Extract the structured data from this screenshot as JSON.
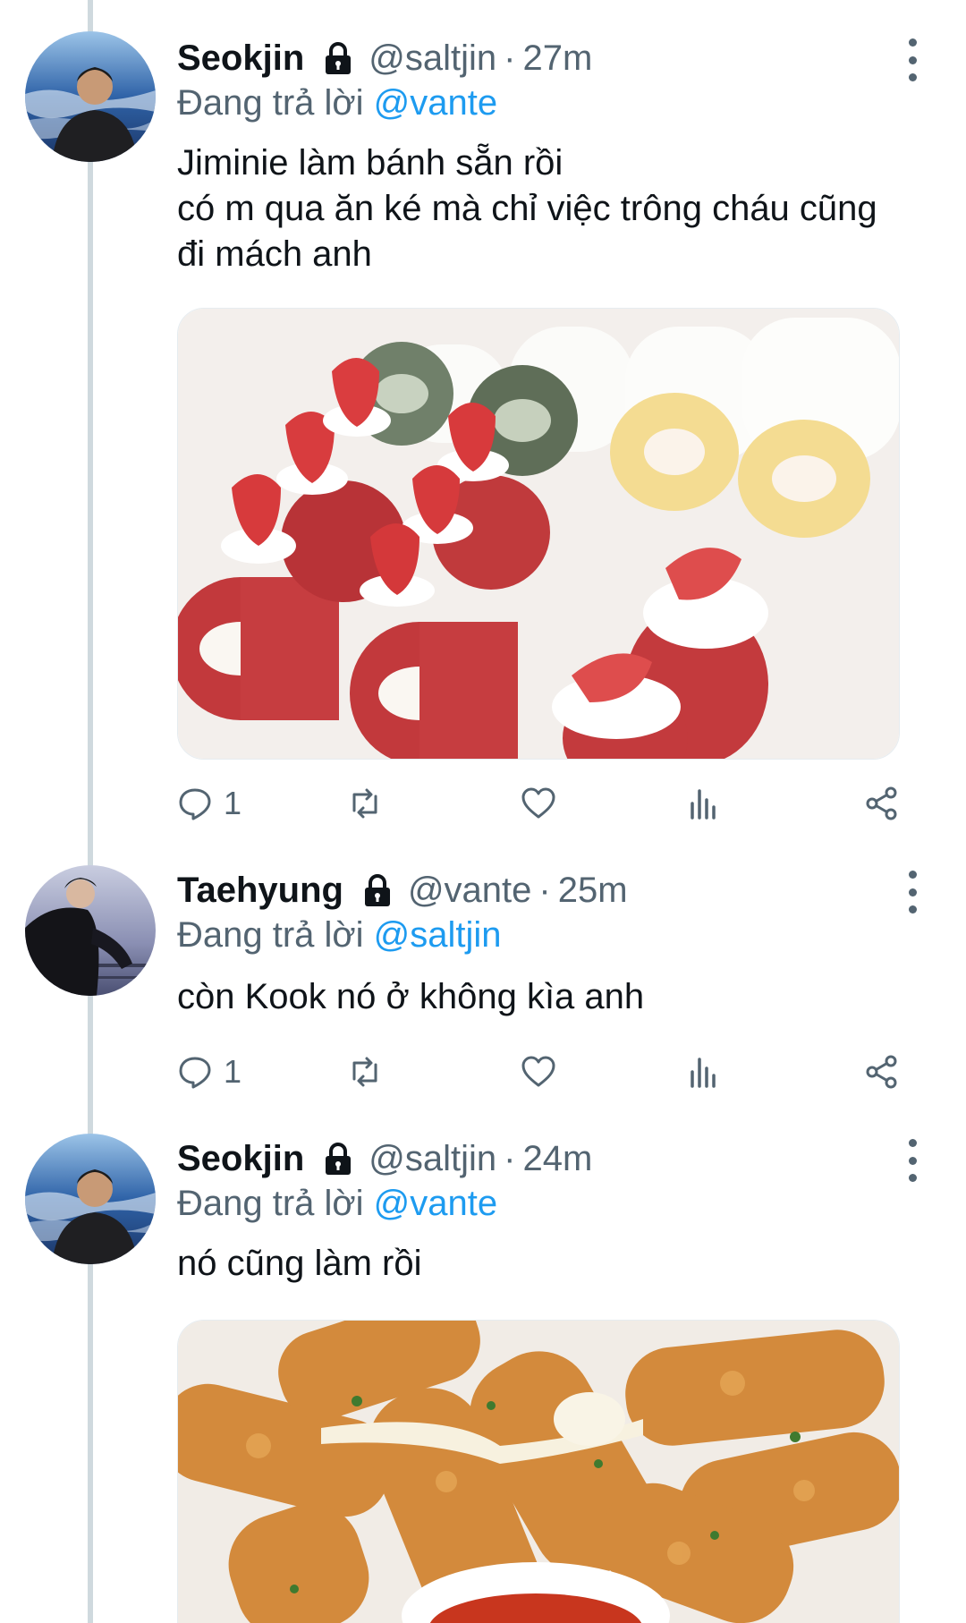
{
  "reply_prefix": "Đang trả lời",
  "tweets": [
    {
      "name": "Seokjin",
      "handle": "@saltjin",
      "separator": "·",
      "time": "27m",
      "reply_to": "@vante",
      "text_lines": [
        "Jiminie làm bánh sẵn rồi",
        "có m qua ăn ké mà chỉ việc trông cháu cũng",
        "đi mách anh"
      ],
      "media_description": "strawberry-roll-cakes-photo",
      "reply_count": "1"
    },
    {
      "name": "Taehyung",
      "handle": "@vante",
      "separator": "·",
      "time": "25m",
      "reply_to": "@saltjin",
      "text_lines": [
        "còn Kook nó ở không kìa anh"
      ],
      "reply_count": "1"
    },
    {
      "name": "Seokjin",
      "handle": "@saltjin",
      "separator": "·",
      "time": "24m",
      "reply_to": "@vante",
      "text_lines": [
        "nó cũng làm rồi"
      ],
      "media_description": "fried-cheese-sticks-photo"
    }
  ],
  "colors": {
    "link": "#1d9bf0",
    "secondary": "#536471",
    "thread_line": "#cfd9de"
  }
}
